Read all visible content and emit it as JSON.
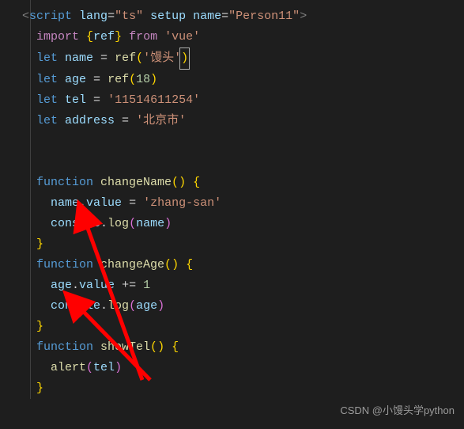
{
  "code": {
    "scriptOpen": {
      "lt": "<",
      "tag": "script",
      "sp1": " ",
      "attr1": "lang",
      "eq1": "=",
      "val1": "\"ts\"",
      "sp2": " ",
      "attr2": "setup",
      "sp3": " ",
      "attr3": "name",
      "eq3": "=",
      "val3": "\"Person11\"",
      "gt": ">"
    },
    "l2": {
      "kw": "import ",
      "lb": "{",
      "id": "ref",
      "rb": "}",
      "from": " from ",
      "mod": "'vue'"
    },
    "l3": {
      "let": "let ",
      "name": "name",
      "eq": " = ",
      "fn": "ref",
      "lp": "(",
      "arg": "'馒头'",
      "rp": ")"
    },
    "l4": {
      "let": "let ",
      "name": "age",
      "eq": " = ",
      "fn": "ref",
      "lp": "(",
      "arg": "18",
      "rp": ")"
    },
    "l5": {
      "let": "let ",
      "name": "tel",
      "eq": " = ",
      "val": "'11514611254'"
    },
    "l6": {
      "let": "let ",
      "name": "address",
      "eq": " = ",
      "val": "'北京市'"
    },
    "fn1": {
      "kw": "function ",
      "name": "changeName",
      "lp": "(",
      "rp": ")",
      "sp": " ",
      "lb": "{"
    },
    "fn1b1": {
      "obj": "name",
      "dot": ".",
      "prop": "value",
      "eq": " = ",
      "val": "'zhang-san'"
    },
    "fn1b2": {
      "obj": "console",
      "dot": ".",
      "method": "log",
      "lp": "(",
      "arg": "name",
      "rp": ")"
    },
    "fn1e": {
      "rb": "}"
    },
    "fn2": {
      "kw": "function ",
      "name": "changeAge",
      "lp": "(",
      "rp": ")",
      "sp": " ",
      "lb": "{"
    },
    "fn2b1": {
      "obj": "age",
      "dot": ".",
      "prop": "value",
      "op": " += ",
      "val": "1"
    },
    "fn2b2": {
      "obj": "console",
      "dot": ".",
      "method": "log",
      "lp": "(",
      "arg": "age",
      "rp": ")"
    },
    "fn2e": {
      "rb": "}"
    },
    "fn3": {
      "kw": "function ",
      "name": "showTel",
      "lp": "(",
      "rp": ")",
      "sp": " ",
      "lb": "{"
    },
    "fn3b1": {
      "fn": "alert",
      "lp": "(",
      "arg": "tel",
      "rp": ")"
    },
    "fn3e": {
      "rb": "}"
    }
  },
  "watermark": "CSDN @小馒头学python"
}
